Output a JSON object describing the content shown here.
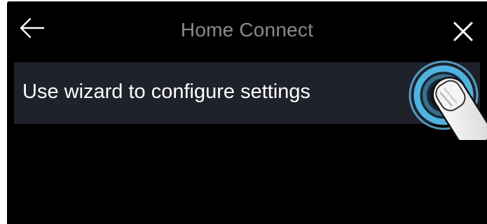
{
  "header": {
    "title": "Home Connect",
    "back_icon": "arrow-left-icon",
    "close_icon": "close-icon"
  },
  "settings": {
    "items": [
      {
        "label": "Use wizard to configure settings"
      }
    ]
  },
  "colors": {
    "screen_background": "#000000",
    "row_background": "#1f222b",
    "title_text": "#8a8a8a",
    "primary_text": "#ffffff",
    "touch_accent": "#4fb3e0"
  },
  "overlay": {
    "icon": "finger-tap-icon"
  }
}
